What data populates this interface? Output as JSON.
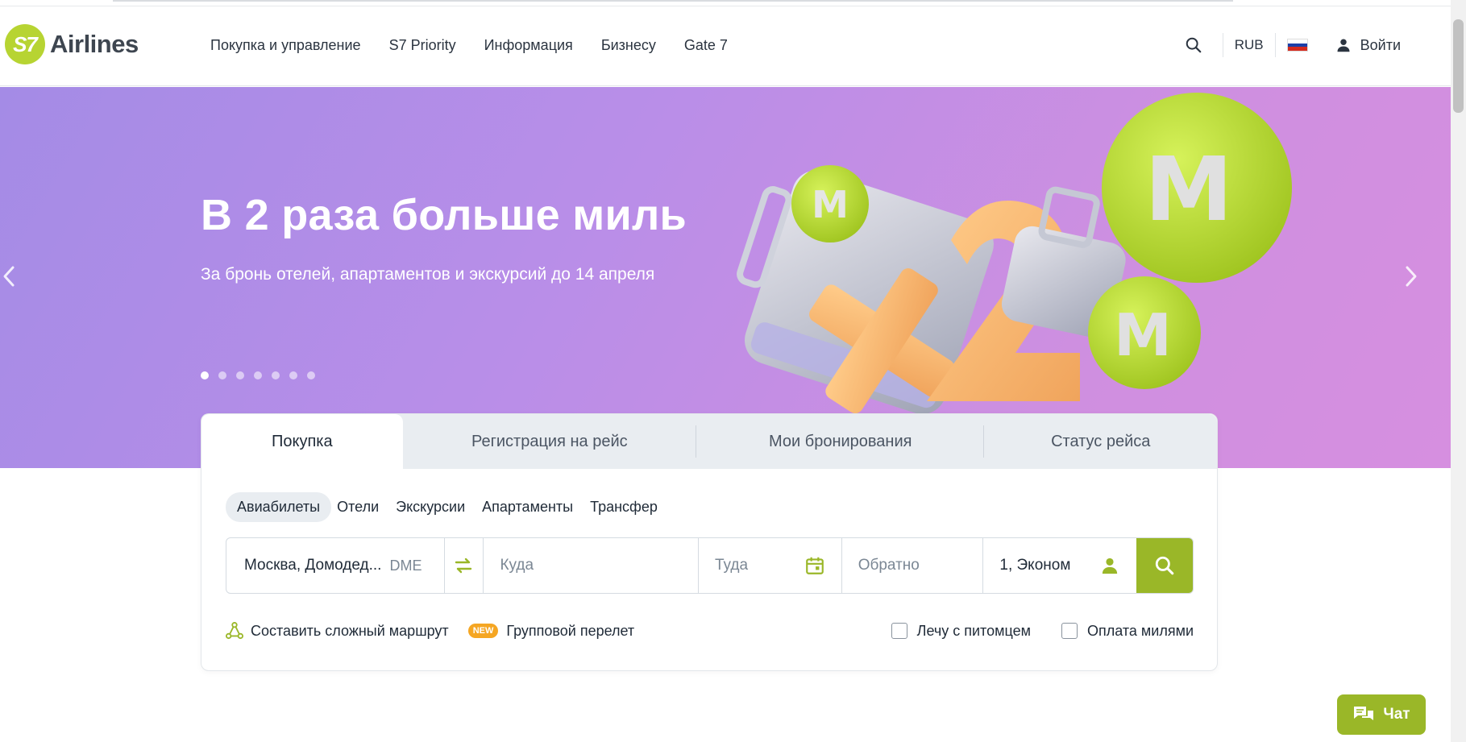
{
  "header": {
    "logo_mark": "S7",
    "logo_text": "Airlines",
    "nav": [
      {
        "label": "Покупка и управление"
      },
      {
        "label": "S7 Priority"
      },
      {
        "label": "Информация"
      },
      {
        "label": "Бизнесу"
      },
      {
        "label": "Gate 7"
      }
    ],
    "currency": "RUB",
    "login_label": "Войти"
  },
  "hero": {
    "title": "В 2 раза больше миль",
    "subtitle": "За бронь отелей, апартаментов и экскурсий до 14 апреля",
    "slides_total": 7,
    "active_slide": 1
  },
  "booking": {
    "tabs": [
      {
        "label": "Покупка",
        "active": true
      },
      {
        "label": "Регистрация на рейс",
        "active": false
      },
      {
        "label": "Мои бронирования",
        "active": false
      },
      {
        "label": "Статус рейса",
        "active": false
      }
    ],
    "subtabs": [
      {
        "label": "Авиабилеты",
        "active": true
      },
      {
        "label": "Отели",
        "active": false
      },
      {
        "label": "Экскурсии",
        "active": false
      },
      {
        "label": "Апартаменты",
        "active": false
      },
      {
        "label": "Трансфер",
        "active": false
      }
    ],
    "from_value": "Москва, Домодед...",
    "from_code": "DME",
    "to_placeholder": "Куда",
    "depart_placeholder": "Туда",
    "return_placeholder": "Обратно",
    "passengers_value": "1, Эконом",
    "complex_route_label": "Составить сложный маршрут",
    "new_badge": "NEW",
    "group_flight_label": "Групповой перелет",
    "pet_label": "Лечу с питомцем",
    "miles_label": "Оплата милями"
  },
  "chat": {
    "label": "Чат"
  },
  "colors": {
    "brand_green": "#9ab728",
    "logo_green": "#b7d432",
    "badge_orange": "#f5a623"
  }
}
